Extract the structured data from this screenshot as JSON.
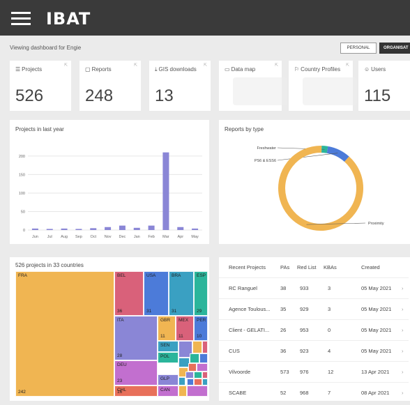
{
  "header": {
    "logo": "IBAT"
  },
  "dashboard": {
    "viewing_text": "Viewing dashboard for Engie",
    "personal_label": "PERSONAL",
    "org_label": "ORGANISAT"
  },
  "stats": [
    {
      "label": "Projects",
      "value": "526",
      "icon": "projects-icon"
    },
    {
      "label": "Reports",
      "value": "248",
      "icon": "reports-icon"
    },
    {
      "label": "GIS downloads",
      "value": "13",
      "icon": "download-icon"
    },
    {
      "label": "Data map",
      "value": "",
      "icon": "map-icon"
    },
    {
      "label": "Country Profiles",
      "value": "",
      "icon": "flag-icon"
    },
    {
      "label": "Users",
      "value": "115",
      "icon": "users-icon"
    }
  ],
  "projects_chart": {
    "title": "Projects in last year",
    "chart_data": {
      "type": "bar",
      "categories": [
        "Jun",
        "Jul",
        "Aug",
        "Sep",
        "Oct",
        "Nov",
        "Dec",
        "Jan",
        "Feb",
        "Mar",
        "Apr",
        "May"
      ],
      "values": [
        4,
        3,
        4,
        3,
        5,
        8,
        12,
        6,
        12,
        210,
        8,
        4
      ],
      "ylim": [
        0,
        230
      ],
      "yticks": [
        "0",
        "50",
        "100",
        "150",
        "200"
      ],
      "color": "#8a86d6"
    }
  },
  "reports_chart": {
    "title": "Reports by type",
    "chart_data": {
      "type": "pie",
      "labels": [
        "Freshwater",
        "PS6 & ESS6",
        "Proximity"
      ],
      "values": [
        6,
        22,
        220
      ],
      "colors": [
        "#2bb59b",
        "#4c7bd9",
        "#f0b552"
      ]
    }
  },
  "treemap": {
    "title": "526 projects in 33 countries",
    "cells": [
      {
        "label": "FRA",
        "value": "242",
        "color": "#f0b552"
      },
      {
        "label": "BEL",
        "value": "36",
        "color": "#d9617a"
      },
      {
        "label": "USA",
        "value": "31",
        "color": "#4c7bd9"
      },
      {
        "label": "BRA",
        "value": "31",
        "color": "#3aa0c2"
      },
      {
        "label": "ESP",
        "value": "29",
        "color": "#2bb59b"
      },
      {
        "label": "ITA",
        "value": "28",
        "color": "#8a86d6"
      },
      {
        "label": "GBR",
        "value": "11",
        "color": "#f0b552"
      },
      {
        "label": "MEX",
        "value": "11",
        "color": "#d9617a"
      },
      {
        "label": "PER",
        "value": "10",
        "color": "#4c7bd9"
      },
      {
        "label": "DEU",
        "value": "23",
        "color": "#c26fcf"
      },
      {
        "label": "SEN",
        "value": "",
        "color": "#3aa0c2"
      },
      {
        "label": "POL",
        "value": "",
        "color": "#2bb59b"
      },
      {
        "label": "CHL",
        "value": "16",
        "color": "#e8705a"
      },
      {
        "label": "GLP",
        "value": "",
        "color": "#8a86d6"
      },
      {
        "label": "CAN",
        "value": "",
        "color": "#c26fcf"
      }
    ]
  },
  "recent": {
    "headers": [
      "Recent Projects",
      "PAs",
      "Red List",
      "KBAs",
      "Created"
    ],
    "rows": [
      {
        "name": "RC Ranguel",
        "pas": "38",
        "redlist": "933",
        "kbas": "3",
        "created": "05 May 2021"
      },
      {
        "name": "Agence Toulous...",
        "pas": "35",
        "redlist": "929",
        "kbas": "3",
        "created": "05 May 2021"
      },
      {
        "name": "Client - GELATI...",
        "pas": "26",
        "redlist": "953",
        "kbas": "0",
        "created": "05 May 2021"
      },
      {
        "name": "CUS",
        "pas": "36",
        "redlist": "923",
        "kbas": "4",
        "created": "05 May 2021"
      },
      {
        "name": "Vilvoorde",
        "pas": "573",
        "redlist": "976",
        "kbas": "12",
        "created": "13 Apr 2021"
      },
      {
        "name": "SCABE",
        "pas": "52",
        "redlist": "968",
        "kbas": "7",
        "created": "08 Apr 2021"
      }
    ],
    "chevron": "›"
  }
}
